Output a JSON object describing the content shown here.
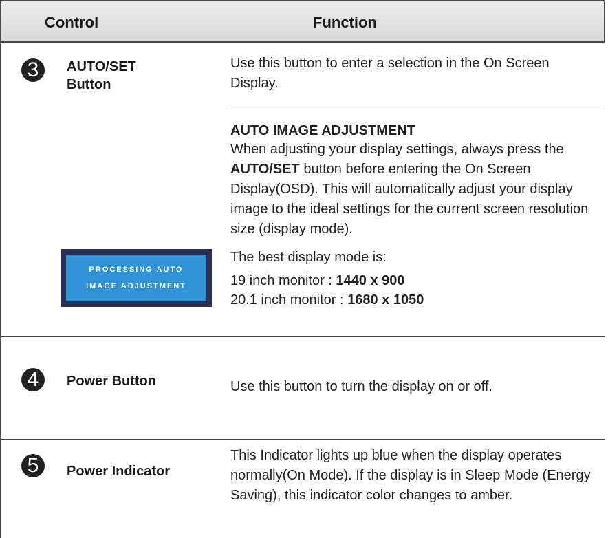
{
  "header": {
    "control": "Control",
    "function": "Function"
  },
  "rows": [
    {
      "number": "3",
      "control": [
        "AUTO/SET",
        "Button"
      ],
      "function_intro": "Use this button to enter a selection in the On Screen Display.",
      "section_title": "AUTO IMAGE ADJUSTMENT",
      "section_body": {
        "p1": "When adjusting your display settings, always press the ",
        "bold": "AUTO/SET",
        "p2": " button before entering the On Screen Display(OSD). This will automatically adjust your display image to the ideal settings for the current screen resolution size (display mode)."
      },
      "best_mode_label": "The best display mode is:",
      "modes": [
        {
          "label": "19 inch monitor : ",
          "value": "1440 x 900"
        },
        {
          "label": "20.1 inch monitor : ",
          "value": "1680 x 1050"
        }
      ],
      "osd": [
        "PROCESSING AUTO",
        "IMAGE ADJUSTMENT"
      ]
    },
    {
      "number": "4",
      "control": [
        "Power Button"
      ],
      "function_text": "Use this button to turn the display on or off."
    },
    {
      "number": "5",
      "control": [
        "Power Indicator"
      ],
      "function_text": "This Indicator lights up blue when the display operates normally(On Mode). If the display is in Sleep Mode (Energy Saving), this indicator color changes to amber."
    }
  ]
}
